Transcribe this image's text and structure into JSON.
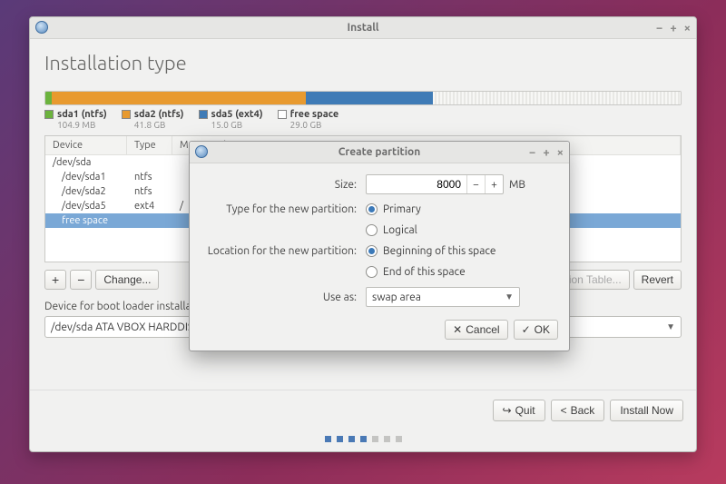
{
  "window": {
    "title": "Install"
  },
  "page": {
    "heading": "Installation type"
  },
  "legend": [
    {
      "color": "green",
      "label": "sda1 (ntfs)",
      "size": "104.9 MB"
    },
    {
      "color": "orange",
      "label": "sda2 (ntfs)",
      "size": "41.8 GB"
    },
    {
      "color": "blue",
      "label": "sda5 (ext4)",
      "size": "15.0 GB"
    },
    {
      "color": "empty",
      "label": "free space",
      "size": "29.0 GB"
    }
  ],
  "tree": {
    "cols": {
      "device": "Device",
      "type": "Type",
      "mount": "Mount point"
    },
    "rows": [
      {
        "device": "/dev/sda",
        "type": "",
        "mount": "",
        "indent": false,
        "selected": false
      },
      {
        "device": "/dev/sda1",
        "type": "ntfs",
        "mount": "",
        "indent": true,
        "selected": false
      },
      {
        "device": "/dev/sda2",
        "type": "ntfs",
        "mount": "",
        "indent": true,
        "selected": false
      },
      {
        "device": "/dev/sda5",
        "type": "ext4",
        "mount": "/",
        "indent": true,
        "selected": false
      },
      {
        "device": "free space",
        "type": "",
        "mount": "",
        "indent": true,
        "selected": true
      }
    ]
  },
  "toolbar": {
    "add": "+",
    "remove": "−",
    "change": "Change...",
    "new_table": "New Partition Table...",
    "revert": "Revert"
  },
  "boot": {
    "label": "Device for boot loader installation:",
    "value": "/dev/sda   ATA VBOX HARDDISK"
  },
  "footer": {
    "quit": "Quit",
    "back": "Back",
    "install": "Install Now"
  },
  "dialog": {
    "title": "Create partition",
    "size_label": "Size:",
    "size_value": "8000",
    "size_unit": "MB",
    "type_label": "Type for the new partition:",
    "type_primary": "Primary",
    "type_logical": "Logical",
    "loc_label": "Location for the new partition:",
    "loc_begin": "Beginning of this space",
    "loc_end": "End of this space",
    "use_label": "Use as:",
    "use_value": "swap area",
    "cancel": "Cancel",
    "ok": "OK"
  }
}
